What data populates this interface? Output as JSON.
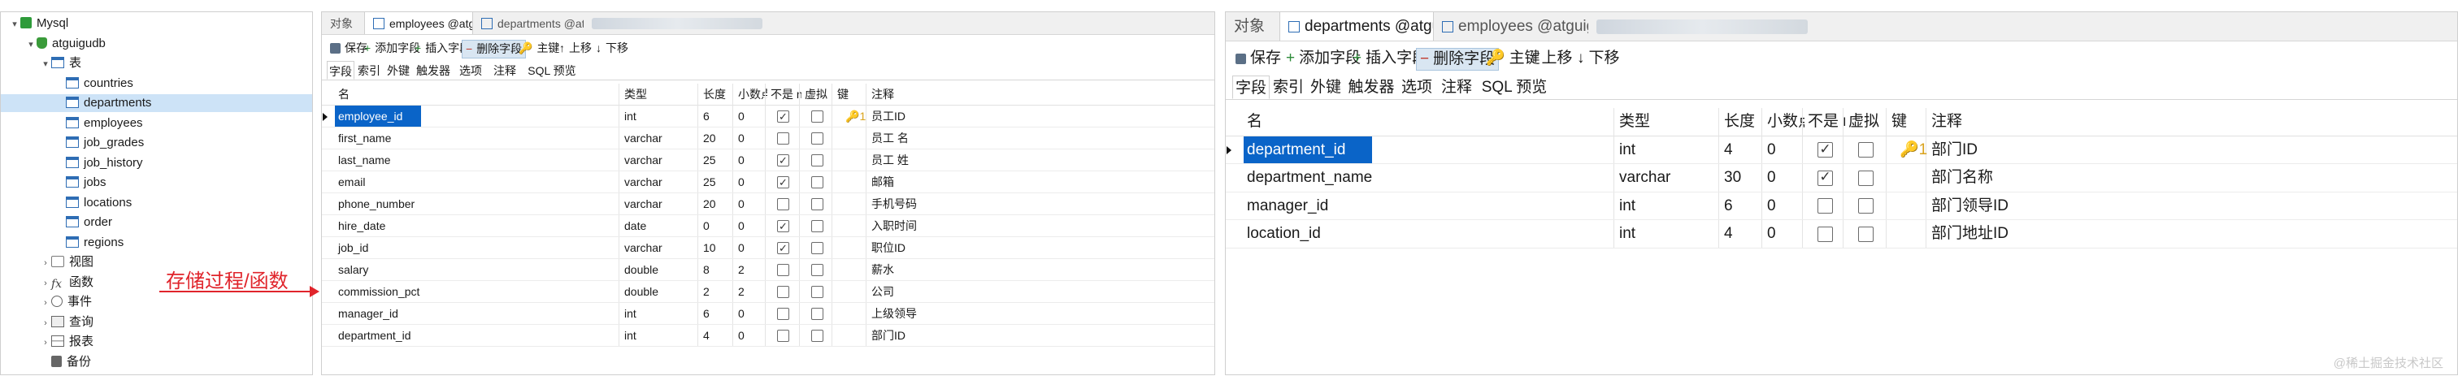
{
  "tree": {
    "root": "Mysql",
    "database": "atguigudb",
    "tables_folder": "表",
    "tables": [
      "countries",
      "departments",
      "employees",
      "job_grades",
      "job_history",
      "jobs",
      "locations",
      "order",
      "regions"
    ],
    "selected_table": "departments",
    "folders": [
      {
        "label": "视图",
        "icon": "view-icon"
      },
      {
        "label": "函数",
        "icon": "function-icon"
      },
      {
        "label": "事件",
        "icon": "event-icon"
      },
      {
        "label": "查询",
        "icon": "query-icon"
      },
      {
        "label": "报表",
        "icon": "report-icon"
      },
      {
        "label": "备份",
        "icon": "backup-icon"
      }
    ]
  },
  "annotation": {
    "text": "存储过程/函数",
    "color": "#e0242b"
  },
  "designer_left": {
    "tabs": [
      "对象",
      "employees @atguigudb (M...",
      "departments @atguigudb (..."
    ],
    "toolbar": [
      "保存",
      "添加字段",
      "插入字段",
      "删除字段",
      "主键",
      "上移",
      "下移"
    ],
    "subtabs": [
      "字段",
      "索引",
      "外键",
      "触发器",
      "选项",
      "注释",
      "SQL 预览"
    ],
    "columns": [
      "名",
      "类型",
      "长度",
      "小数点",
      "不是 null",
      "虚拟",
      "键",
      "注释"
    ],
    "rows": [
      {
        "name": "employee_id",
        "type": "int",
        "length": "6",
        "decimals": "0",
        "not_null": true,
        "virtual": false,
        "key": "1",
        "comment": "员工ID"
      },
      {
        "name": "first_name",
        "type": "varchar",
        "length": "20",
        "decimals": "0",
        "not_null": false,
        "virtual": false,
        "key": "",
        "comment": "员工 名"
      },
      {
        "name": "last_name",
        "type": "varchar",
        "length": "25",
        "decimals": "0",
        "not_null": true,
        "virtual": false,
        "key": "",
        "comment": "员工 姓"
      },
      {
        "name": "email",
        "type": "varchar",
        "length": "25",
        "decimals": "0",
        "not_null": true,
        "virtual": false,
        "key": "",
        "comment": "邮箱"
      },
      {
        "name": "phone_number",
        "type": "varchar",
        "length": "20",
        "decimals": "0",
        "not_null": false,
        "virtual": false,
        "key": "",
        "comment": "手机号码"
      },
      {
        "name": "hire_date",
        "type": "date",
        "length": "0",
        "decimals": "0",
        "not_null": true,
        "virtual": false,
        "key": "",
        "comment": "入职时间"
      },
      {
        "name": "job_id",
        "type": "varchar",
        "length": "10",
        "decimals": "0",
        "not_null": true,
        "virtual": false,
        "key": "",
        "comment": "职位ID"
      },
      {
        "name": "salary",
        "type": "double",
        "length": "8",
        "decimals": "2",
        "not_null": false,
        "virtual": false,
        "key": "",
        "comment": "薪水"
      },
      {
        "name": "commission_pct",
        "type": "double",
        "length": "2",
        "decimals": "2",
        "not_null": false,
        "virtual": false,
        "key": "",
        "comment": "公司"
      },
      {
        "name": "manager_id",
        "type": "int",
        "length": "6",
        "decimals": "0",
        "not_null": false,
        "virtual": false,
        "key": "",
        "comment": "上级领导"
      },
      {
        "name": "department_id",
        "type": "int",
        "length": "4",
        "decimals": "0",
        "not_null": false,
        "virtual": false,
        "key": "",
        "comment": "部门ID"
      }
    ]
  },
  "designer_right": {
    "tabs": [
      "对象",
      "departments @atguigudb (...",
      "employees @atguigudb (M..."
    ],
    "toolbar": [
      "保存",
      "添加字段",
      "插入字段",
      "删除字段",
      "主键",
      "上移",
      "下移"
    ],
    "subtabs": [
      "字段",
      "索引",
      "外键",
      "触发器",
      "选项",
      "注释",
      "SQL 预览"
    ],
    "columns": [
      "名",
      "类型",
      "长度",
      "小数点",
      "不是 null",
      "虚拟",
      "键",
      "注释"
    ],
    "rows": [
      {
        "name": "department_id",
        "type": "int",
        "length": "4",
        "decimals": "0",
        "not_null": true,
        "virtual": false,
        "key": "1",
        "comment": "部门ID"
      },
      {
        "name": "department_name",
        "type": "varchar",
        "length": "30",
        "decimals": "0",
        "not_null": true,
        "virtual": false,
        "key": "",
        "comment": "部门名称"
      },
      {
        "name": "manager_id",
        "type": "int",
        "length": "6",
        "decimals": "0",
        "not_null": false,
        "virtual": false,
        "key": "",
        "comment": "部门领导ID"
      },
      {
        "name": "location_id",
        "type": "int",
        "length": "4",
        "decimals": "0",
        "not_null": false,
        "virtual": false,
        "key": "",
        "comment": "部门地址ID"
      }
    ]
  },
  "watermark": "@稀土掘金技术社区"
}
